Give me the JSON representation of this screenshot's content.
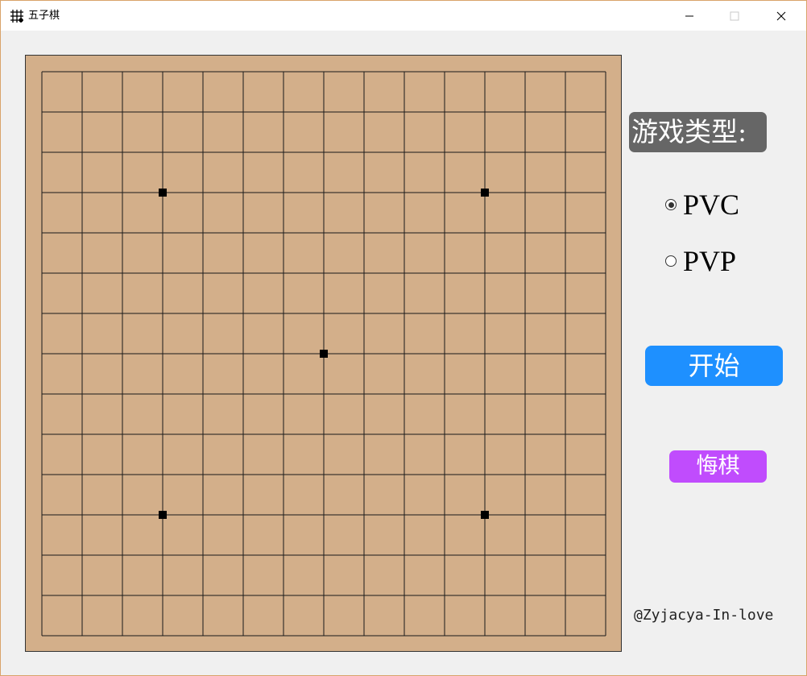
{
  "window": {
    "title": "五子棋",
    "icon": "grid-board-icon",
    "controls": [
      "minimize-icon",
      "maximize-icon",
      "close-icon"
    ]
  },
  "board": {
    "lines": 15,
    "board_color": "#d3af8a",
    "line_color": "#1a1a1a",
    "star_points": [
      [
        3,
        3
      ],
      [
        11,
        3
      ],
      [
        7,
        7
      ],
      [
        3,
        11
      ],
      [
        11,
        11
      ]
    ]
  },
  "sidebar": {
    "game_type_label": "游戏类型:",
    "modes": [
      {
        "label": "PVC",
        "selected": true
      },
      {
        "label": "PVP",
        "selected": false
      }
    ],
    "start_label": "开始",
    "undo_label": "悔棋",
    "credit": "@Zyjacya-In-love",
    "colors": {
      "label_bg": "#666666",
      "start_bg": "#1e90ff",
      "undo_bg": "#c04cfd"
    }
  }
}
